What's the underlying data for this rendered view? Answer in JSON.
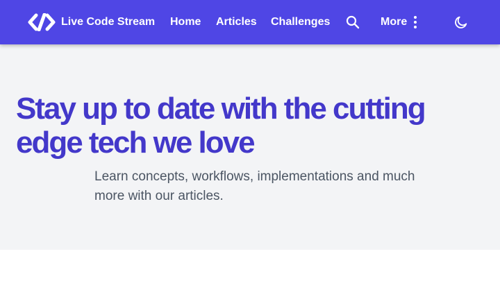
{
  "navbar": {
    "background": "#4f46e5",
    "brand": {
      "label": "Live Code Stream",
      "icon": "code-logo-icon"
    },
    "links": [
      {
        "label": "Home"
      },
      {
        "label": "Articles"
      },
      {
        "label": "Challenges"
      }
    ],
    "search": {
      "icon": "search-icon"
    },
    "more": {
      "label": "More",
      "icon": "vertical-dots-icon"
    },
    "theme_toggle": {
      "icon": "moon-icon"
    }
  },
  "hero": {
    "background": "#f3f4f6",
    "title": "Stay up to date with the cutting edge tech we love",
    "title_color": "#4338ca",
    "subtitle": "Learn concepts, workflows, implementations and much more with our articles.",
    "subtitle_color": "#4b5563"
  }
}
